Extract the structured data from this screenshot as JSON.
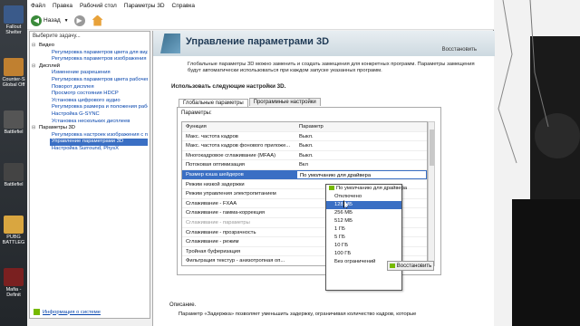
{
  "desktop": {
    "icons": [
      {
        "label": "Fallout Shelter",
        "color": "#3a5a8a"
      },
      {
        "label": "Counter-S Global Off",
        "color": "#c08030"
      },
      {
        "label": "Battlefiel",
        "color": "#555555"
      },
      {
        "label": "Battlefiel",
        "color": "#444444"
      },
      {
        "label": "PUBG BATTLEG",
        "color": "#d9a640"
      },
      {
        "label": "Mafia - Definit",
        "color": "#7a2020"
      }
    ]
  },
  "window": {
    "menu": [
      "Файл",
      "Правка",
      "Рабочий стол",
      "Параметры 3D",
      "Справка"
    ],
    "toolbar": {
      "back_label": "Назад",
      "back_icon": "back-arrow-icon",
      "forward_icon": "forward-arrow-icon",
      "home_icon": "home-icon"
    },
    "sidebar": {
      "title": "Выберите задачу...",
      "tree": [
        {
          "type": "cat",
          "label": "Видео"
        },
        {
          "type": "sub",
          "label": "Регулировка параметров цвета для вид"
        },
        {
          "type": "sub",
          "label": "Регулировка параметров изображения д"
        },
        {
          "type": "cat",
          "label": "Дисплей"
        },
        {
          "type": "sub",
          "label": "Изменение разрешения"
        },
        {
          "type": "sub",
          "label": "Регулировка параметров цвета рабочег"
        },
        {
          "type": "sub",
          "label": "Поворот дисплея"
        },
        {
          "type": "sub",
          "label": "Просмотр состояния HDCP"
        },
        {
          "type": "sub",
          "label": "Установка цифрового аудио"
        },
        {
          "type": "sub",
          "label": "Регулировка размера и положения рабо"
        },
        {
          "type": "sub",
          "label": "Настройка G-SYNC"
        },
        {
          "type": "sub",
          "label": "Установка нескольких дисплеев"
        },
        {
          "type": "cat",
          "label": "Параметры 3D"
        },
        {
          "type": "sub",
          "label": "Регулировка настроек изображения с пр"
        },
        {
          "type": "sel",
          "label": "Управление параметрами 3D"
        },
        {
          "type": "sub",
          "label": "Настройка Surround, PhysX"
        }
      ],
      "sysinfo_label": "Информация о системе"
    },
    "main": {
      "title": "Управление параметрами 3D",
      "restore_link": "Восстановить",
      "intro": "Глобальные параметры 3D можно заменить и создать замещения для конкретных программ. Параметры замещения будут автоматически использоваться при каждом запуске указанных программ.",
      "section_title": "Использовать следующие настройки 3D.",
      "tabs": [
        {
          "label": "Глобальные параметры",
          "active": true
        },
        {
          "label": "Программные настройки",
          "active": false
        }
      ],
      "params_label": "Параметры:",
      "grid_header": {
        "c1": "Функция",
        "c2": "Параметр"
      },
      "rows": [
        {
          "c1": "Макс. частота кадров",
          "c2": "Выкл.",
          "state": ""
        },
        {
          "c1": "Макс. частота кадров фонового приложе...",
          "c2": "Выкл.",
          "state": ""
        },
        {
          "c1": "Многокадровое сглаживание (MFAA)",
          "c2": "Выкл.",
          "state": ""
        },
        {
          "c1": "Потоковая оптимизация",
          "c2": "Вкл",
          "state": ""
        },
        {
          "c1": "Размер кэша шейдеров",
          "c2": "По умолчанию для драйвера",
          "state": "hl"
        },
        {
          "c1": "Режим низкой задержки",
          "c2": "",
          "state": ""
        },
        {
          "c1": "Режим управления электропитанием",
          "c2": "",
          "state": ""
        },
        {
          "c1": "Сглаживание - FXAA",
          "c2": "",
          "state": ""
        },
        {
          "c1": "Сглаживание - гамма-коррекция",
          "c2": "",
          "state": ""
        },
        {
          "c1": "Сглаживание - параметры",
          "c2": "",
          "state": "dim"
        },
        {
          "c1": "Сглаживание - прозрачность",
          "c2": "",
          "state": ""
        },
        {
          "c1": "Сглаживание - режим",
          "c2": "",
          "state": ""
        },
        {
          "c1": "Тройная буферизация",
          "c2": "",
          "state": ""
        },
        {
          "c1": "Фильтрация текстур - анизотропная оп...",
          "c2": "",
          "state": ""
        }
      ],
      "dropdown": [
        {
          "label": "По умолчанию для драйвера",
          "state": "first"
        },
        {
          "label": "Отключено",
          "state": ""
        },
        {
          "label": "128 МБ",
          "state": "sel"
        },
        {
          "label": "256 МБ",
          "state": ""
        },
        {
          "label": "512 МБ",
          "state": ""
        },
        {
          "label": "1 ГБ",
          "state": ""
        },
        {
          "label": "5 ГБ",
          "state": ""
        },
        {
          "label": "10 ГБ",
          "state": ""
        },
        {
          "label": "100 ГБ",
          "state": ""
        },
        {
          "label": "Без ограничений",
          "state": ""
        }
      ],
      "restore_button": "Восстановить",
      "desc_title": "Описание.",
      "desc_text": "Параметр «Задержка» позволяет уменьшить задержку, ограничивая количество кадров, которые"
    }
  }
}
